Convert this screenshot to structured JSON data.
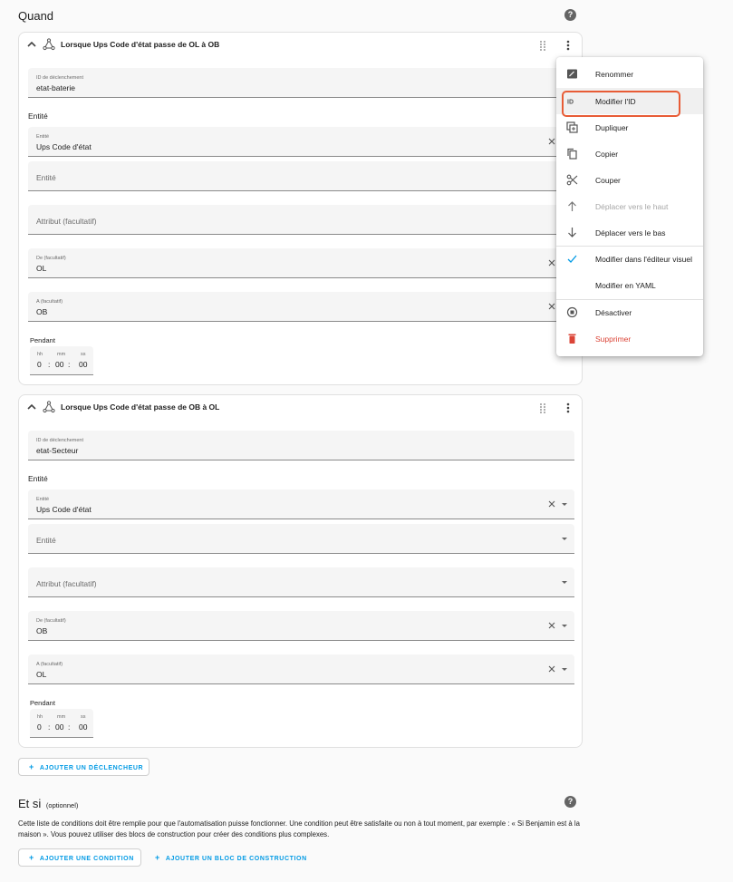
{
  "when": {
    "title": "Quand",
    "help_icon": "help-circle-icon"
  },
  "triggers": [
    {
      "title": "Lorsque Ups Code d'état passe de OL à OB",
      "id_label": "ID de déclenchement",
      "id_value": "etat-baterie",
      "entity_group": "Entité",
      "entity_label": "Entité",
      "entity_value": "Ups Code d'état",
      "entity2_placeholder": "Entité",
      "attribute_placeholder": "Attribut (facultatif)",
      "from_label": "De (facultatif)",
      "from_value": "OL",
      "to_label": "A (facultatif)",
      "to_value": "OB",
      "duration_label": "Pendant",
      "hh_label": "hh",
      "hh": "0",
      "mm_label": "mm",
      "mm": "00",
      "ss_label": "ss",
      "ss": "00",
      "sep": ":"
    },
    {
      "title": "Lorsque Ups Code d'état passe de OB à OL",
      "id_label": "ID de déclenchement",
      "id_value": "etat-Secteur",
      "entity_group": "Entité",
      "entity_label": "Entité",
      "entity_value": "Ups Code d'état",
      "entity2_placeholder": "Entité",
      "attribute_placeholder": "Attribut (facultatif)",
      "from_label": "De (facultatif)",
      "from_value": "OB",
      "to_label": "A (facultatif)",
      "to_value": "OL",
      "duration_label": "Pendant",
      "hh_label": "hh",
      "hh": "0",
      "mm_label": "mm",
      "mm": "00",
      "ss_label": "ss",
      "ss": "00",
      "sep": ":"
    }
  ],
  "add_trigger_label": "AJOUTER UN DÉCLENCHEUR",
  "conditions": {
    "title": "Et si",
    "subtitle": "(optionnel)",
    "description": "Cette liste de conditions doit être remplie pour que l'automatisation puisse fonctionner. Une condition peut être satisfaite ou non à tout moment, par exemple : « Si Benjamin est à la maison ». Vous pouvez utiliser des blocs de construction pour créer des conditions plus complexes.",
    "add_condition_label": "AJOUTER UNE CONDITION",
    "add_block_label": "AJOUTER UN BLOC DE CONSTRUCTION"
  },
  "menu": {
    "items": [
      {
        "label": "Renommer",
        "icon": "rename-icon"
      },
      {
        "label": "Modifier l'ID",
        "icon": "id-icon"
      },
      {
        "label": "Dupliquer",
        "icon": "duplicate-icon"
      },
      {
        "label": "Copier",
        "icon": "copy-icon"
      },
      {
        "label": "Couper",
        "icon": "scissors-icon"
      },
      {
        "label": "Déplacer vers le haut",
        "icon": "arrow-up-icon",
        "disabled": true
      },
      {
        "label": "Déplacer vers le bas",
        "icon": "arrow-down-icon"
      },
      {
        "label": "Modifier dans l'éditeur visuel",
        "icon": "check-icon"
      },
      {
        "label": "Modifier en YAML",
        "icon": ""
      },
      {
        "label": "Désactiver",
        "icon": "stop-circle-icon"
      },
      {
        "label": "Supprimer",
        "icon": "delete-icon"
      }
    ]
  },
  "colors": {
    "accent": "#039be5",
    "danger": "#db4437",
    "highlight": "#e85c36"
  }
}
